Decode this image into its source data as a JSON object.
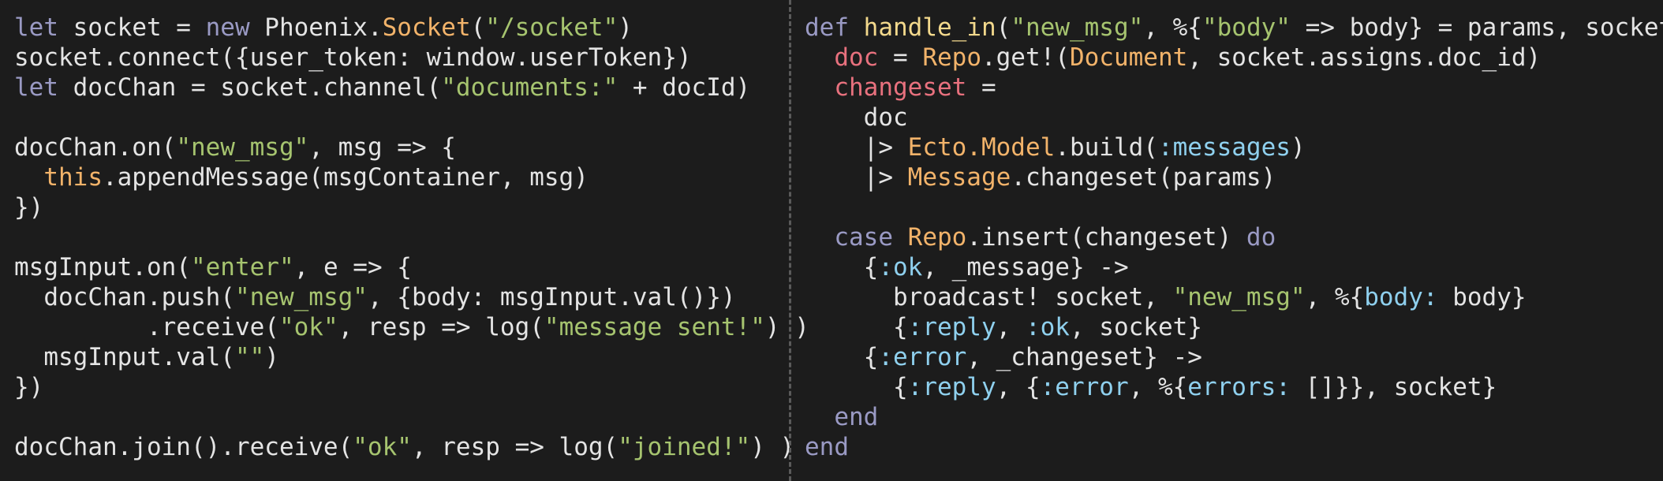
{
  "colors": {
    "background": "#1c1c1c",
    "plain": "#e4e4e4",
    "keyword": "#9a9ac4",
    "class": "#f2b36a",
    "string": "#a6c46f",
    "function": "#f3d98c",
    "variable": "#e8717e",
    "atom": "#8fd0ee",
    "divider": "#5a5a5a"
  },
  "panes": {
    "left": {
      "language": "javascript",
      "lines": [
        [
          [
            "kw",
            "let"
          ],
          [
            "plain",
            " socket = "
          ],
          [
            "kw",
            "new"
          ],
          [
            "plain",
            " Phoenix."
          ],
          [
            "cls",
            "Socket"
          ],
          [
            "plain",
            "("
          ],
          [
            "str",
            "\"/socket\""
          ],
          [
            "plain",
            ")"
          ]
        ],
        [
          [
            "plain",
            "socket.connect({user_token: window.userToken})"
          ]
        ],
        [
          [
            "kw",
            "let"
          ],
          [
            "plain",
            " docChan = socket.channel("
          ],
          [
            "str",
            "\"documents:\""
          ],
          [
            "plain",
            " + docId)"
          ]
        ],
        [],
        [
          [
            "plain",
            "docChan.on("
          ],
          [
            "str",
            "\"new_msg\""
          ],
          [
            "plain",
            ", msg => {"
          ]
        ],
        [
          [
            "plain",
            "  "
          ],
          [
            "cls",
            "this"
          ],
          [
            "plain",
            ".appendMessage(msgContainer, msg)"
          ]
        ],
        [
          [
            "plain",
            "})"
          ]
        ],
        [],
        [
          [
            "plain",
            "msgInput.on("
          ],
          [
            "str",
            "\"enter\""
          ],
          [
            "plain",
            ", e => {"
          ]
        ],
        [
          [
            "plain",
            "  docChan.push("
          ],
          [
            "str",
            "\"new_msg\""
          ],
          [
            "plain",
            ", {body: msgInput.val()})"
          ]
        ],
        [
          [
            "plain",
            "         .receive("
          ],
          [
            "str",
            "\"ok\""
          ],
          [
            "plain",
            ", resp => log("
          ],
          [
            "str",
            "\"message sent!\""
          ],
          [
            "plain",
            ") )"
          ]
        ],
        [
          [
            "plain",
            "  msgInput.val("
          ],
          [
            "str",
            "\"\""
          ],
          [
            "plain",
            ")"
          ]
        ],
        [
          [
            "plain",
            "})"
          ]
        ],
        [],
        [
          [
            "plain",
            "docChan.join().receive("
          ],
          [
            "str",
            "\"ok\""
          ],
          [
            "plain",
            ", resp => log("
          ],
          [
            "str",
            "\"joined!\""
          ],
          [
            "plain",
            ") )"
          ]
        ]
      ]
    },
    "right": {
      "language": "elixir",
      "lines": [
        [
          [
            "kw",
            "def"
          ],
          [
            "plain",
            " "
          ],
          [
            "fn",
            "handle_in"
          ],
          [
            "plain",
            "("
          ],
          [
            "str",
            "\"new_msg\""
          ],
          [
            "plain",
            ", %{"
          ],
          [
            "str",
            "\"body\""
          ],
          [
            "plain",
            " => body} = params, socket)"
          ]
        ],
        [
          [
            "plain",
            "  "
          ],
          [
            "var",
            "doc"
          ],
          [
            "plain",
            " = "
          ],
          [
            "cls",
            "Repo"
          ],
          [
            "plain",
            ".get!("
          ],
          [
            "cls",
            "Document"
          ],
          [
            "plain",
            ", socket.assigns.doc_id)"
          ]
        ],
        [
          [
            "plain",
            "  "
          ],
          [
            "var",
            "changeset"
          ],
          [
            "plain",
            " ="
          ]
        ],
        [
          [
            "plain",
            "    doc"
          ]
        ],
        [
          [
            "plain",
            "    |> "
          ],
          [
            "cls",
            "Ecto.Model"
          ],
          [
            "plain",
            ".build("
          ],
          [
            "atom",
            ":messages"
          ],
          [
            "plain",
            ")"
          ]
        ],
        [
          [
            "plain",
            "    |> "
          ],
          [
            "cls",
            "Message"
          ],
          [
            "plain",
            ".changeset(params)"
          ]
        ],
        [],
        [
          [
            "plain",
            "  "
          ],
          [
            "kw",
            "case"
          ],
          [
            "plain",
            " "
          ],
          [
            "cls",
            "Repo"
          ],
          [
            "plain",
            ".insert(changeset) "
          ],
          [
            "kw",
            "do"
          ]
        ],
        [
          [
            "plain",
            "    {"
          ],
          [
            "atom",
            ":ok"
          ],
          [
            "plain",
            ", _message} ->"
          ]
        ],
        [
          [
            "plain",
            "      broadcast! socket, "
          ],
          [
            "str",
            "\"new_msg\""
          ],
          [
            "plain",
            ", %{"
          ],
          [
            "atom",
            "body:"
          ],
          [
            "plain",
            " body}"
          ]
        ],
        [
          [
            "plain",
            "      {"
          ],
          [
            "atom",
            ":reply"
          ],
          [
            "plain",
            ", "
          ],
          [
            "atom",
            ":ok"
          ],
          [
            "plain",
            ", socket}"
          ]
        ],
        [
          [
            "plain",
            "    {"
          ],
          [
            "atom",
            ":error"
          ],
          [
            "plain",
            ", _changeset} ->"
          ]
        ],
        [
          [
            "plain",
            "      {"
          ],
          [
            "atom",
            ":reply"
          ],
          [
            "plain",
            ", {"
          ],
          [
            "atom",
            ":error"
          ],
          [
            "plain",
            ", %{"
          ],
          [
            "atom",
            "errors:"
          ],
          [
            "plain",
            " []}}, socket}"
          ]
        ],
        [
          [
            "plain",
            "  "
          ],
          [
            "kw",
            "end"
          ]
        ],
        [
          [
            "kw",
            "end"
          ]
        ]
      ]
    }
  }
}
